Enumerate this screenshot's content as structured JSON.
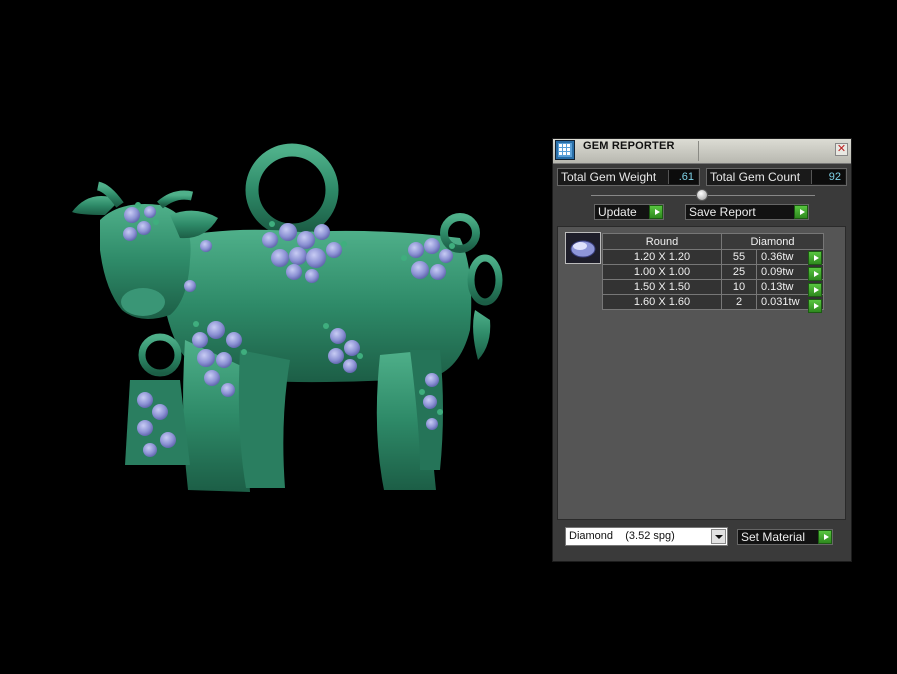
{
  "panel": {
    "title": "GEM REPORTER",
    "close_glyph": "✕",
    "total_weight_label": "Total Gem Weight",
    "total_weight_value": ".61",
    "total_count_label": "Total Gem Count",
    "total_count_value": "92",
    "update_label": "Update",
    "save_report_label": "Save Report",
    "table": {
      "headers": [
        "Round",
        "Diamond"
      ],
      "rows": [
        {
          "size": "1.20 X 1.20",
          "count": "55",
          "weight": "0.36tw"
        },
        {
          "size": "1.00 X 1.00",
          "count": "25",
          "weight": "0.09tw"
        },
        {
          "size": "1.50 X 1.50",
          "count": "10",
          "weight": "0.13tw"
        },
        {
          "size": "1.60 X 1.60",
          "count": "2",
          "weight": "0.031tw"
        }
      ]
    },
    "material_selected": "Diamond    (3.52 spg)",
    "set_material_label": "Set Material"
  },
  "colors": {
    "metal": "#2e8a6a",
    "gem": "#8e96d8",
    "accent_green": "#3fa82a",
    "value_text": "#7fd3e8"
  },
  "icons": {
    "panel_icon": "gem-reporter-icon",
    "close": "close-icon",
    "arrow": "play-arrow-icon",
    "dropdown": "chevron-down-icon",
    "thumbnail": "round-gem-icon"
  }
}
